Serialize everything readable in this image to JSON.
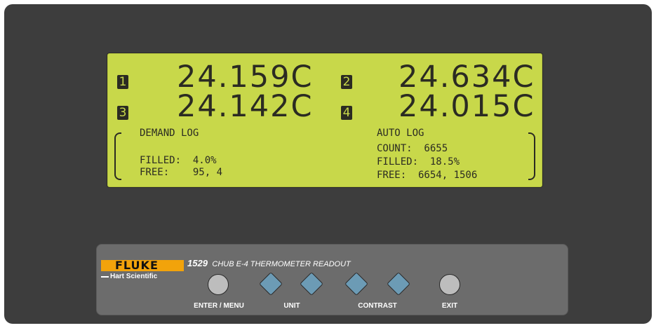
{
  "display": {
    "channels": [
      {
        "num": "1",
        "reading": "24.159C"
      },
      {
        "num": "2",
        "reading": "24.634C"
      },
      {
        "num": "3",
        "reading": "24.142C"
      },
      {
        "num": "4",
        "reading": "24.015C"
      }
    ],
    "demand_log": {
      "title": "DEMAND LOG",
      "filled": "FILLED:  4.0%",
      "free": "FREE:    95, 4"
    },
    "auto_log": {
      "title": "AUTO LOG",
      "count": "COUNT:  6655",
      "filled": "FILLED:  18.5%",
      "free": "FREE:  6654, 1506"
    }
  },
  "panel": {
    "brand": "FLUKE",
    "sub_brand": "Hart Scientific",
    "model_number": "1529",
    "model_title": "CHUB E-4 THERMOMETER READOUT",
    "buttons": {
      "enter_menu": "ENTER / MENU",
      "unit": "UNIT",
      "contrast": "CONTRAST",
      "exit": "EXIT"
    }
  },
  "colors": {
    "lcd_background": "#c8d84a",
    "lcd_text": "#2b2b22",
    "housing": "#3d3d3d",
    "panel": "#6c6c6c",
    "brand_accent": "#f2a30b",
    "arrow_buttons": "#6c9bb5"
  }
}
